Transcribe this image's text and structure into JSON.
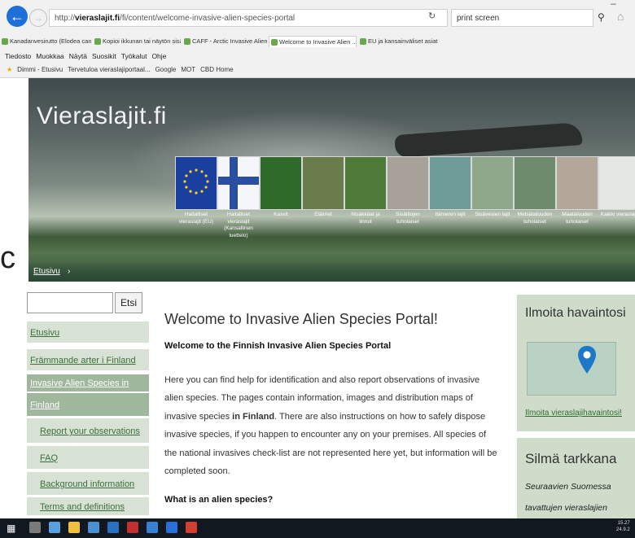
{
  "browser": {
    "url_prefix": "http://",
    "url_host": "vieraslajit.fi",
    "url_path": "/fi/content/welcome-invasive-alien-species-portal",
    "search_value": "print screen",
    "tabs": [
      "Kanadanvesirutto (Elodea cana...",
      "Kopioi ikkunan tai näytön sisält...",
      "CAFF - Arctic Invasive Alien Sp...",
      "Welcome to Invasive Alien ...",
      "EU ja kansainväliset asiat - Ma..."
    ],
    "menu": [
      "Tiedosto",
      "Muokkaa",
      "Näytä",
      "Suosikit",
      "Työkalut",
      "Ohje"
    ],
    "favorites": [
      "Dimmi - Etusivu",
      "Tervetuloa vieraslajiportaal...",
      "Google",
      "MOT",
      "CBD Home"
    ]
  },
  "banner": {
    "site_title": "Vieraslajit.fi",
    "breadcrumb": "Etusivu",
    "breadcrumb_sep": "›",
    "tiles": [
      {
        "label": "Haitalliset vieraslajit (EU)",
        "color": "#1a3f9e"
      },
      {
        "label": "Haitalliset vieraslajit (Kansallinen luettelo)",
        "color": "#f4f6fb"
      },
      {
        "label": "Kasvit",
        "color": "#2f6a2a"
      },
      {
        "label": "Eläimet",
        "color": "#6b7c4c"
      },
      {
        "label": "Nisäkkäat ja linnut",
        "color": "#4e7a3a"
      },
      {
        "label": "Sisätilojen tuholaiset",
        "color": "#a7a199"
      },
      {
        "label": "Itämeren lajit",
        "color": "#6f9c98"
      },
      {
        "label": "Sisävesien lajit",
        "color": "#8da88a"
      },
      {
        "label": "Metsätalouden tuholaiset",
        "color": "#6e8c6c"
      },
      {
        "label": "Maatalouden tuholaiset",
        "color": "#b3a79a"
      },
      {
        "label": "Kaikki vieraslajit",
        "color": "#e4e8e2"
      }
    ]
  },
  "edge_glyph": "c",
  "sidebar": {
    "search_button": "Etsi",
    "items": [
      {
        "label": "Etusivu",
        "type": "top"
      },
      {
        "label": "Främmande arter i Finland",
        "type": "top"
      },
      {
        "label": "Invasive Alien Species in",
        "type": "dark"
      },
      {
        "label": "Finland",
        "type": "dark"
      },
      {
        "label": "Report your observations",
        "type": "sub"
      },
      {
        "label": "FAQ",
        "type": "sub"
      },
      {
        "label": "Background information",
        "type": "sub"
      },
      {
        "label": "Terms and definitions",
        "type": "sub"
      }
    ]
  },
  "main": {
    "title": "Welcome to Invasive Alien Species Portal!",
    "subtitle": "Welcome to the Finnish Invasive Alien Species Portal",
    "para_1": "Here you can find help for identification and also report observations of invasive alien species. The pages contain information, images and distribution maps of invasive species ",
    "para_bold": "in Finland",
    "para_2": ". There are also instructions on how to safely dispose invasive species, if you happen to encounter any on your premises. All species of the national invasives check-list are not represented here yet, but information will be completed soon.",
    "section_title": "What is an alien species?"
  },
  "right": {
    "report_title": "Ilmoita havaintosi",
    "report_link": "Ilmoita vieraslajihavaintosi!",
    "watch_title": "Silmä tarkkana",
    "watch_line_1": "Seuraavien Suomessa",
    "watch_line_2": "tavattujen vieraslajien"
  },
  "taskbar": {
    "time": "15.27",
    "date": "24.9.2"
  }
}
